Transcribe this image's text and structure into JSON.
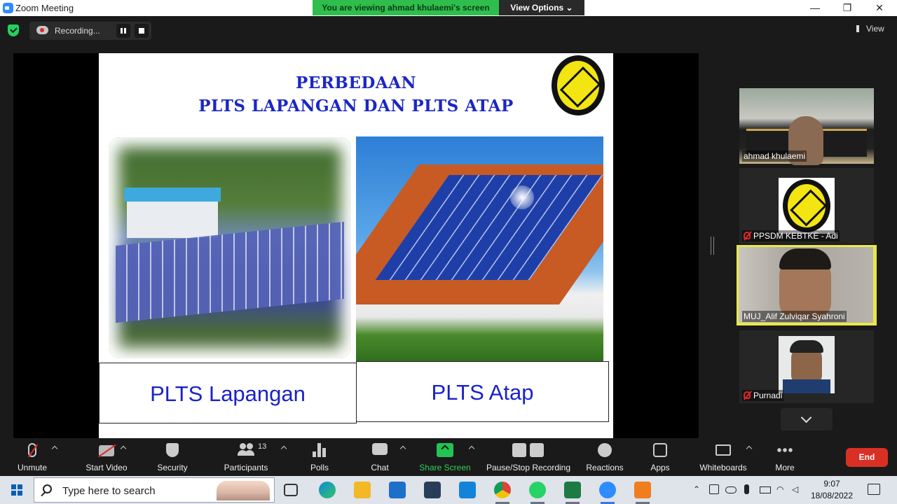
{
  "window": {
    "title": "Zoom Meeting",
    "viewing_banner": "You are viewing ahmad khulaemi's screen",
    "view_options": "View Options ⌄",
    "controls": [
      "—",
      "❐",
      "✕"
    ]
  },
  "topbar": {
    "recording_label": "Recording...",
    "view_label": "View",
    "security_color": "#23d160"
  },
  "slide": {
    "title_line1": "PERBEDAAN",
    "title_line2": "PLTS LAPANGAN DAN PLTS ATAP",
    "left_caption": "PLTS Lapangan",
    "right_caption": "PLTS Atap",
    "caption_color": "#1a22c9"
  },
  "participants": [
    {
      "name": "ahmad khulaemi",
      "muted": false
    },
    {
      "name": "PPSDM KEBTKE - Adi",
      "muted": true
    },
    {
      "name": "MUJ_Alif Zulviqar Syahroni",
      "muted": false,
      "active_speaker": true
    },
    {
      "name": "Purnadi",
      "muted": true
    }
  ],
  "toolbar": {
    "unmute": "Unmute",
    "start_video": "Start Video",
    "security": "Security",
    "participants": "Participants",
    "participants_count": "13",
    "polls": "Polls",
    "chat": "Chat",
    "share_screen": "Share Screen",
    "pause_stop_recording": "Pause/Stop Recording",
    "reactions": "Reactions",
    "apps": "Apps",
    "whiteboards": "Whiteboards",
    "more": "More",
    "end": "End"
  },
  "taskbar": {
    "search_placeholder": "Type here to search",
    "time": "9:07",
    "date": "18/08/2022",
    "pinned": [
      "task-view",
      "edge",
      "file-explorer",
      "mail",
      "calculator",
      "l-app",
      "chrome",
      "whatsapp",
      "excel",
      "zoom",
      "ocr-app"
    ]
  }
}
